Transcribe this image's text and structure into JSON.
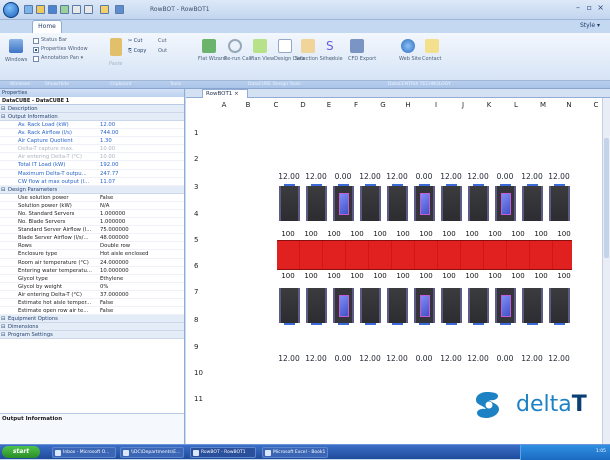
{
  "titlebar": {
    "title": "RowBOT - RowBOT1",
    "style_label": "Style ▾"
  },
  "ribbon": {
    "home_tab": "Home",
    "windows": {
      "label": "Windows",
      "status_bar": "Status Bar",
      "properties_window": "Properties Window",
      "annotation_pan": "Annotation Pan ▾"
    },
    "clipboard": {
      "paste": "Paste",
      "cut": "Cut",
      "copy": "Copy",
      "cut_short": "Cut",
      "paste_short": "Out"
    },
    "tools": [
      {
        "label": "Flat\nWizard"
      },
      {
        "label": "Re-run\nCalc"
      },
      {
        "label": "Plan\nView"
      },
      {
        "label": "Design\nData"
      },
      {
        "label": "Selection\nSchedule"
      },
      {
        "label": "Project"
      },
      {
        "label": "CFD\nExport"
      }
    ],
    "web": {
      "label": "Web\nSite"
    },
    "contact": {
      "label": "Contact"
    },
    "groups": [
      "Windows",
      "Show/Hide",
      "Clipboard",
      "Tools",
      "DataCUBE Design Tools",
      "DataCENTRIX TECHNOLOGY"
    ]
  },
  "left": {
    "header": "Properties",
    "object": "DataCUBE - DataCUBE 1",
    "description_section": "Description",
    "output_section": "Output Information",
    "output_rows": [
      {
        "k": "Av. Rack Load (kW)",
        "v": "12.00",
        "c": "blue"
      },
      {
        "k": "Av. Rack Airflow (l/s)",
        "v": "744.00",
        "c": "blue"
      },
      {
        "k": "Air Capture Quotient",
        "v": "1.30",
        "c": "blue"
      },
      {
        "k": "Delta-T capture max.",
        "v": "10.00",
        "c": "gray"
      },
      {
        "k": "Air entering Delta-T (°C)",
        "v": "10.00",
        "c": "gray"
      },
      {
        "k": "Total IT Load (kW)",
        "v": "192.00",
        "c": "blue"
      },
      {
        "k": "Maximum Delta-T outpu...",
        "v": "247.77",
        "c": "blue"
      },
      {
        "k": "CW flow at max output (l...",
        "v": "11.07",
        "c": "blue"
      }
    ],
    "design_section": "Design Parameters",
    "design_rows": [
      {
        "k": "Use solution power",
        "v": "False"
      },
      {
        "k": "Solution power (kW)",
        "v": "N/A"
      },
      {
        "k": "No. Standard Servers",
        "v": "1.000000"
      },
      {
        "k": "No. Blade Servers",
        "v": "1.000000"
      },
      {
        "k": "Standard Server Airflow (l...",
        "v": "75.000000"
      },
      {
        "k": "Blade Server Airflow (l/s/...",
        "v": "48.000000"
      },
      {
        "k": "Rows",
        "v": "Double row"
      },
      {
        "k": "Enclosure type",
        "v": "Hot aisle enclosed"
      },
      {
        "k": "Room air temperature (°C)",
        "v": "24.000000"
      },
      {
        "k": "Entering water temperatu...",
        "v": "10.000000"
      },
      {
        "k": "Glycol type",
        "v": "Ethylene"
      },
      {
        "k": "Glycol by weight",
        "v": "0%"
      },
      {
        "k": "Air entering Delta-T (°C)",
        "v": "37.000000"
      },
      {
        "k": "Estimate hot aisle temper...",
        "v": "False"
      },
      {
        "k": "Estimate open row air te...",
        "v": "False"
      }
    ],
    "equipment_section": "Equipment Options",
    "dimensions_section": "Dimensions",
    "program_section": "Program Settings",
    "footer": "Output Information"
  },
  "main": {
    "doc_tab": "RowBOT1",
    "doc_tab_close": "×",
    "columns": [
      "A",
      "B",
      "C",
      "D",
      "E",
      "F",
      "G",
      "H",
      "I",
      "J",
      "K",
      "L",
      "M",
      "N",
      "C"
    ],
    "rows": [
      "1",
      "2",
      "3",
      "4",
      "5",
      "6",
      "7",
      "8",
      "9",
      "10",
      "11"
    ],
    "top_values": [
      "12.00",
      "12.00",
      "0.00",
      "12.00",
      "12.00",
      "0.00",
      "12.00",
      "12.00",
      "0.00",
      "12.00",
      "12.00"
    ],
    "bottom_values": [
      "12.00",
      "12.00",
      "0.00",
      "12.00",
      "12.00",
      "0.00",
      "12.00",
      "12.00",
      "0.00",
      "12.00",
      "12.00"
    ],
    "airflow_top": [
      "100",
      "100",
      "100",
      "100",
      "100",
      "100",
      "100",
      "100",
      "100",
      "100",
      "100",
      "100",
      "100"
    ],
    "airflow_bottom": [
      "100",
      "100",
      "100",
      "100",
      "100",
      "100",
      "100",
      "100",
      "100",
      "100",
      "100",
      "100",
      "100"
    ]
  },
  "logo": {
    "text": "delta",
    "accent": "T"
  },
  "taskbar": {
    "start": "start",
    "items": [
      "Inbox - Microsoft O...",
      "\\\\DC\\Departments\\E...",
      "RowBOT - RowBOT1",
      "Microsoft Excel - Book1"
    ],
    "clock": "1:05"
  },
  "colors": {
    "accent": "#1d82c3",
    "aisle": "#e12020",
    "cooler": "#5a63e6"
  }
}
